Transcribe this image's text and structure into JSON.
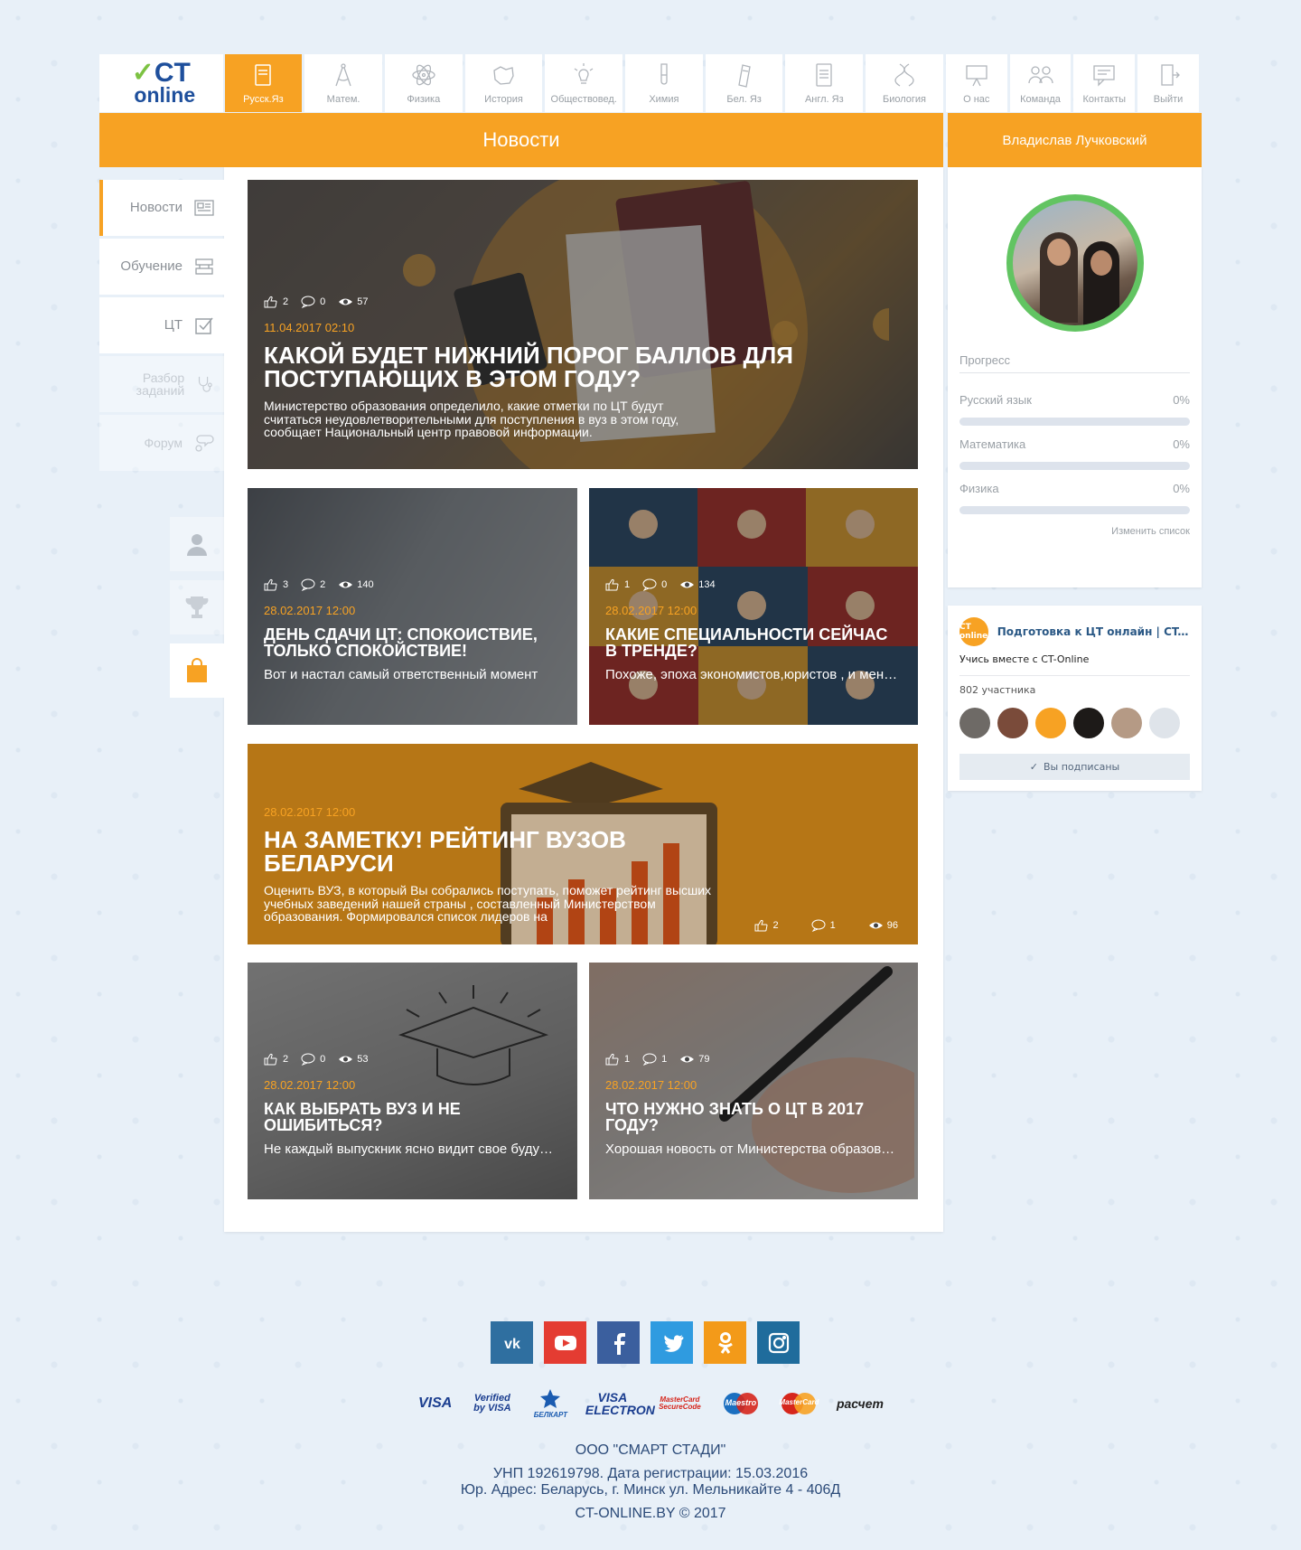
{
  "logo": {
    "ct": "CT",
    "online": "online"
  },
  "nav": {
    "subjects": [
      {
        "label": "Русск.Яз",
        "icon": "book-icon",
        "active": true
      },
      {
        "label": "Матем.",
        "icon": "compass-icon",
        "active": false
      },
      {
        "label": "Физика",
        "icon": "atom-icon",
        "active": false
      },
      {
        "label": "История",
        "icon": "map-icon",
        "active": false
      },
      {
        "label": "Обществовед.",
        "icon": "lightbulb-icon",
        "active": false
      },
      {
        "label": "Химия",
        "icon": "test-tube-icon",
        "active": false
      },
      {
        "label": "Бел. Яз",
        "icon": "notebook-icon",
        "active": false
      },
      {
        "label": "Англ. Яз",
        "icon": "english-notebook-icon",
        "active": false
      },
      {
        "label": "Биология",
        "icon": "dna-icon",
        "active": false
      }
    ],
    "pages": [
      {
        "label": "О нас",
        "icon": "presentation-icon"
      },
      {
        "label": "Команда",
        "icon": "team-icon"
      },
      {
        "label": "Контакты",
        "icon": "chat-icon"
      },
      {
        "label": "Выйти",
        "icon": "logout-icon"
      }
    ]
  },
  "header": {
    "title": "Новости",
    "user_name": "Владислав Лучковский"
  },
  "sidemenu": [
    {
      "label": "Новости",
      "icon": "newspaper-icon"
    },
    {
      "label": "Обучение",
      "icon": "graduation-icon"
    },
    {
      "label": "ЦТ",
      "icon": "checkbox-icon"
    },
    {
      "label": "Разбор заданий",
      "icon": "stethoscope-icon"
    },
    {
      "label": "Форум",
      "icon": "forum-icon"
    }
  ],
  "news": [
    {
      "likes": "2",
      "comments": "0",
      "views": "57",
      "date": "11.04.2017 02:10",
      "title": "Какой будет нижний порог баллов для поступающих в этом году?",
      "desc": "Министерство образования определило, какие отметки по ЦТ будут считаться неудовлетворительными для поступления в вуз в этом году, сообщает Национальный центр правовой информации."
    },
    {
      "likes": "3",
      "comments": "2",
      "views": "140",
      "date": "28.02.2017 12:00",
      "title": "День сдачи ЦТ: спокоиствие, только спокойствие!",
      "desc": "Вот и настал самый ответственный момент"
    },
    {
      "likes": "1",
      "comments": "0",
      "views": "134",
      "date": "28.02.2017 12:00",
      "title": "Какие специальности сейчас в тренде?",
      "desc": "Похоже, эпоха экономистов,юристов , и менеджеров"
    },
    {
      "likes": "2",
      "comments": "1",
      "views": "96",
      "date": "28.02.2017 12:00",
      "title": "На заметку! Рейтинг вузов Беларуси",
      "desc": "Оценить ВУЗ, в который Вы собрались поступать, поможет рейтинг высших учебных заведений нашей страны , составленный Министерством образования. Формировался список лидеров на"
    },
    {
      "likes": "2",
      "comments": "0",
      "views": "53",
      "date": "28.02.2017 12:00",
      "title": "Как выбрать вуз и не ошибиться?",
      "desc": "Не каждый выпускник ясно видит свое будущее"
    },
    {
      "likes": "1",
      "comments": "1",
      "views": "79",
      "date": "28.02.2017 12:00",
      "title": "Что нужно знать о ЦТ в 2017 году?",
      "desc": "Хорошая новость от Министерства образования"
    }
  ],
  "progress": {
    "heading": "Прогресс",
    "items": [
      {
        "subject": "Русский язык",
        "value": "0%",
        "fraction": 0
      },
      {
        "subject": "Математика",
        "value": "0%",
        "fraction": 0
      },
      {
        "subject": "Физика",
        "value": "0%",
        "fraction": 0
      }
    ],
    "edit_label": "Изменить список"
  },
  "vk": {
    "logo_text": "CT online",
    "name": "Подготовка к ЦТ онлайн | CT-Online",
    "subtitle": "Учись вместе с CT-Online",
    "members": "802 участника",
    "subscribed": "Вы подписаны"
  },
  "socials": [
    {
      "name": "vk",
      "icon": "vk-icon",
      "color": "#2f6fa0"
    },
    {
      "name": "youtube",
      "icon": "youtube-icon",
      "color": "#e43c32"
    },
    {
      "name": "facebook",
      "icon": "facebook-icon",
      "color": "#3b5f9e"
    },
    {
      "name": "twitter",
      "icon": "twitter-icon",
      "color": "#2f9be0"
    },
    {
      "name": "odnoklassniki",
      "icon": "ok-icon",
      "color": "#f39a19"
    },
    {
      "name": "instagram",
      "icon": "instagram-icon",
      "color": "#1f6c9c"
    }
  ],
  "payments": [
    "VISA",
    "Verified by VISA",
    "БЕЛКАРТ",
    "VISA ELECTRON",
    "MasterCard SecureCode",
    "Maestro",
    "MasterCard",
    "расчет"
  ],
  "footer": {
    "company": "ООО \"СМАРТ СТАДИ\"",
    "unp": "УНП 192619798. Дата регистрации: 15.03.2016",
    "address": "Юр. Адрес: Беларусь, г. Минск ул. Мельникайте 4 - 406Д",
    "copyright": "CT-ONLINE.BY © 2017"
  },
  "colors": {
    "accent": "#f7a223",
    "progress_ring": "#62c462",
    "link": "#2a5885"
  }
}
